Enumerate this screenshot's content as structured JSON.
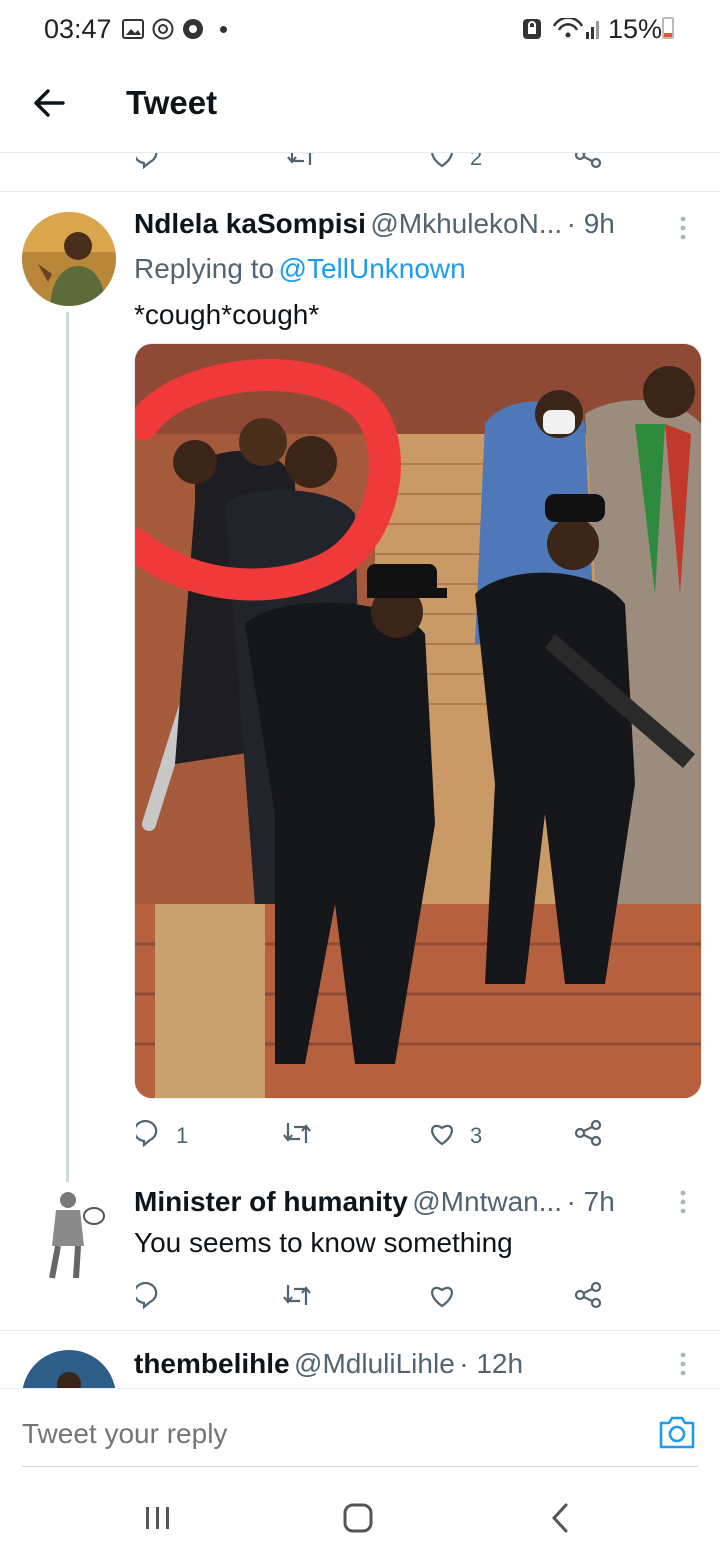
{
  "status_bar": {
    "time": "03:47",
    "battery": "15%"
  },
  "header": {
    "title": "Tweet"
  },
  "prev_actions": {
    "like_count": "2"
  },
  "tweets": [
    {
      "display_name": "Ndlela kaSompisi",
      "handle": "@MkhulekoN...",
      "time": "· 9h",
      "replying_prefix": "Replying to",
      "replying_to": "@TellUnknown",
      "text": "*cough*cough*",
      "reply_count": "1",
      "retweet_count": "",
      "like_count": "3"
    },
    {
      "display_name": "Minister of humanity",
      "handle": "@Mntwan...",
      "time": "· 7h",
      "text": "You seems to know something"
    },
    {
      "display_name": "thembelihle",
      "handle": "@MdluliLihle",
      "time": "· 12h"
    }
  ],
  "composer": {
    "placeholder": "Tweet your reply"
  },
  "colors": {
    "accent": "#1d9bf0",
    "text": "#0f1419",
    "muted": "#536471",
    "divider": "#e6ecf0"
  }
}
